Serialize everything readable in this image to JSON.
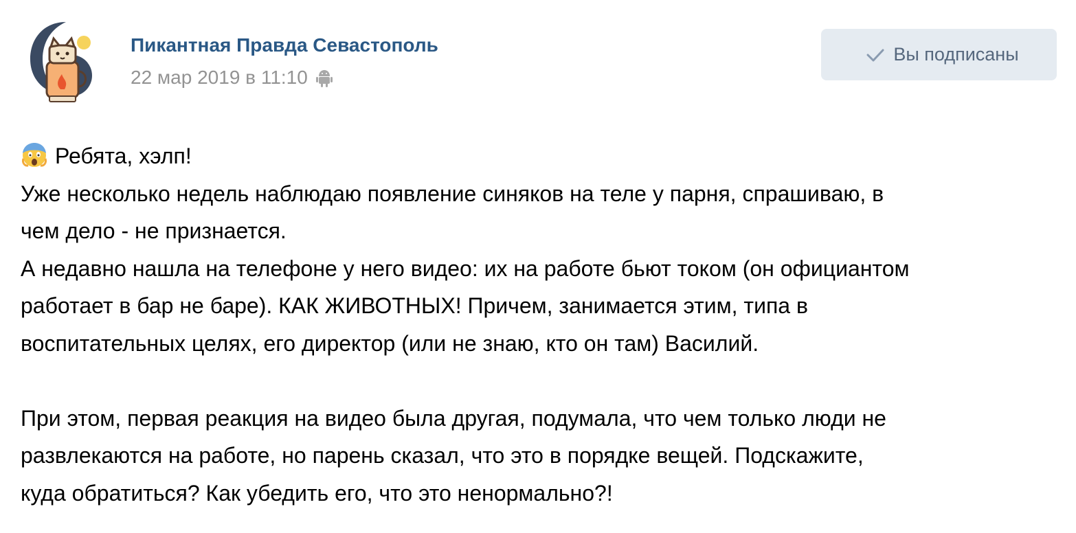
{
  "post": {
    "group_name": "Пикантная Правда Севастополь",
    "date": "22 мар 2019 в 11:10",
    "platform_icon": "android-icon",
    "subscribe_button": {
      "label": "Вы подписаны",
      "icon": "check-icon"
    },
    "avatar_icon": "cat-in-teacup-logo",
    "emoji_icon": "screaming-face-emoji",
    "text_lines": [
      "Ребята, хэлп!",
      "Уже несколько недель наблюдаю появление синяков на теле у парня, спрашиваю, в",
      "чем дело - не признается.",
      "А недавно нашла на телефоне у него видео: их на работе бьют током (он официантом",
      "работает в бар не баре). КАК ЖИВОТНЫХ! Причем, занимается этим, типа в",
      "воспитательных целях, его директор (или не знаю, кто он там) Василий.",
      "",
      "При этом, первая реакция на видео была другая, подумала, что чем только люди не",
      "развлекаются на работе, но парень сказал, что это в порядке вещей. Подскажите,",
      "куда обратиться? Как убедить его, что это ненормально?!"
    ]
  },
  "colors": {
    "link": "#2a5885",
    "meta": "#939393",
    "button_bg": "#e5ebf1",
    "button_text": "#55677d",
    "text": "#000000"
  }
}
